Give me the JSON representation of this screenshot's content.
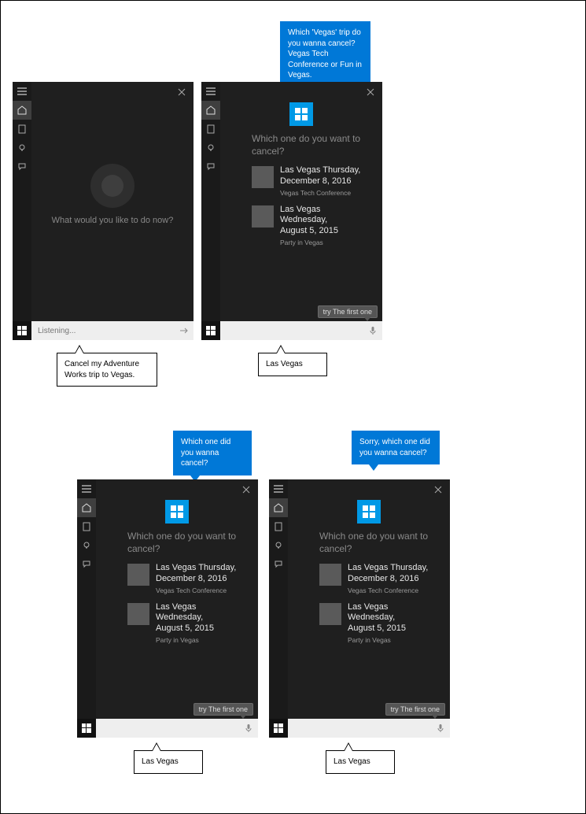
{
  "panel1": {
    "prompt": "What would you like to do now?",
    "input_placeholder": "Listening...",
    "user_speech": "Cancel my Adventure Works trip to Vegas."
  },
  "panel2": {
    "tts": "Which 'Vegas' trip do you wanna cancel? Vegas Tech Conference or Fun in Vegas.",
    "question": "Which one do you want to cancel?",
    "items": [
      {
        "line1": "Las Vegas Thursday,",
        "line2": "December 8, 2016",
        "sub": "Vegas Tech Conference"
      },
      {
        "line1": "Las Vegas Wednesday,",
        "line2": "August 5, 2015",
        "sub": "Party in Vegas"
      }
    ],
    "hint": "try The first one",
    "user_speech": "Las Vegas"
  },
  "panel3": {
    "tts": "Which one did you wanna cancel?",
    "question": "Which one do you want to cancel?",
    "items": [
      {
        "line1": "Las Vegas Thursday,",
        "line2": "December 8, 2016",
        "sub": "Vegas Tech Conference"
      },
      {
        "line1": "Las Vegas Wednesday,",
        "line2": "August 5, 2015",
        "sub": "Party in Vegas"
      }
    ],
    "hint": "try The first one",
    "user_speech": "Las Vegas"
  },
  "panel4": {
    "tts": "Sorry, which one did you wanna cancel?",
    "question": "Which one do you want to cancel?",
    "items": [
      {
        "line1": "Las Vegas Thursday,",
        "line2": "December 8, 2016",
        "sub": "Vegas Tech Conference"
      },
      {
        "line1": "Las Vegas Wednesday,",
        "line2": "August 5, 2015",
        "sub": "Party in Vegas"
      }
    ],
    "hint": "try The first one",
    "user_speech": "Las Vegas"
  }
}
